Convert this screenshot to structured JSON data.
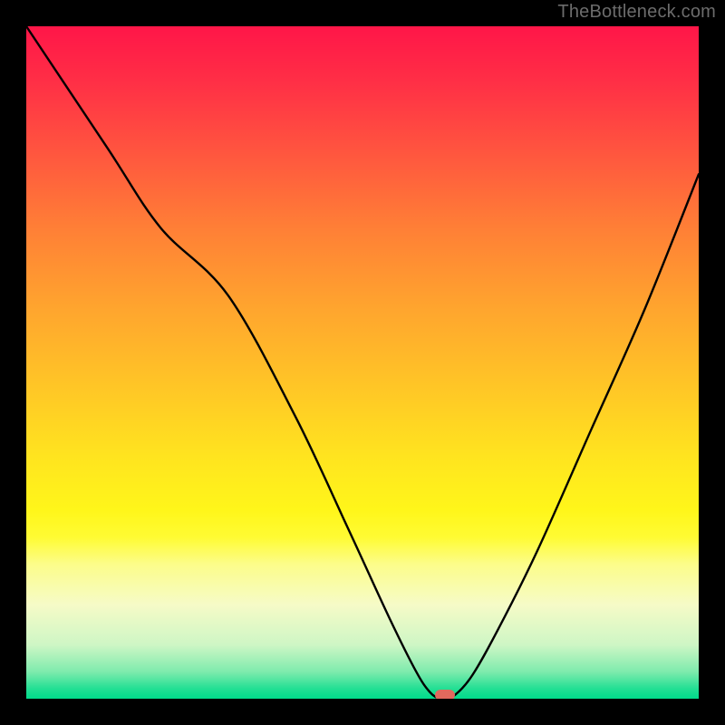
{
  "attribution": "TheBottleneck.com",
  "chart_data": {
    "type": "line",
    "title": "",
    "xlabel": "",
    "ylabel": "",
    "xlim": [
      0,
      100
    ],
    "ylim": [
      0,
      100
    ],
    "series": [
      {
        "name": "bottleneck-curve",
        "x": [
          0,
          12,
          20,
          30,
          40,
          48,
          54,
          58,
          60,
          61.5,
          63,
          66,
          70,
          76,
          84,
          92,
          100
        ],
        "values": [
          100,
          82,
          70,
          60,
          42,
          25,
          12,
          4,
          1,
          0,
          0,
          3,
          10,
          22,
          40,
          58,
          78
        ]
      }
    ],
    "marker": {
      "x": 62.3,
      "y": 0.6
    },
    "gradient_stops": [
      {
        "pos": 0,
        "color": "#ff1648"
      },
      {
        "pos": 8,
        "color": "#ff2e46"
      },
      {
        "pos": 20,
        "color": "#ff5a3e"
      },
      {
        "pos": 30,
        "color": "#ff7f36"
      },
      {
        "pos": 42,
        "color": "#ffa52e"
      },
      {
        "pos": 54,
        "color": "#ffc726"
      },
      {
        "pos": 64,
        "color": "#ffe41f"
      },
      {
        "pos": 72,
        "color": "#fff61a"
      },
      {
        "pos": 76,
        "color": "#fffb33"
      },
      {
        "pos": 80,
        "color": "#fcfd8a"
      },
      {
        "pos": 86,
        "color": "#f6fbc7"
      },
      {
        "pos": 92,
        "color": "#cef6c5"
      },
      {
        "pos": 96,
        "color": "#7eebad"
      },
      {
        "pos": 98.5,
        "color": "#23df94"
      },
      {
        "pos": 100,
        "color": "#00db8b"
      }
    ]
  }
}
